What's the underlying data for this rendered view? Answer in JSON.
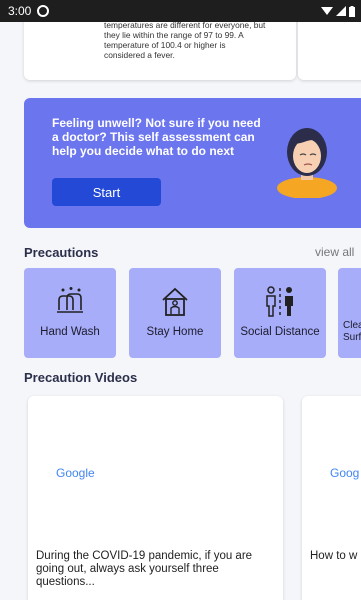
{
  "status_bar": {
    "time": "3:00"
  },
  "info_card": {
    "text": "temperatures are different for everyone, but they lie within the range of 97 to 99. A temperature of 100.4 or higher is considered a fever."
  },
  "assessment": {
    "text": "Feeling unwell? Not sure if you need a doctor? This self assessment can help you decide what to do next",
    "start_label": "Start"
  },
  "precautions": {
    "title": "Precautions",
    "view_all": "view all",
    "items": [
      {
        "label": "Hand Wash",
        "icon": "hand-wash-icon"
      },
      {
        "label": "Stay Home",
        "icon": "home-icon"
      },
      {
        "label": "Social Distance",
        "icon": "social-distance-icon"
      },
      {
        "label": "Clea Surf",
        "icon": "clean-surface-icon"
      }
    ]
  },
  "videos": {
    "title": "Precaution Videos",
    "items": [
      {
        "logo": "Google",
        "caption": "During the COVID-19 pandemic, if you are going out, always ask yourself three questions..."
      },
      {
        "logo": "Goog",
        "caption": "How to w"
      }
    ]
  },
  "colors": {
    "banner": "#6b75ee",
    "button": "#2349d6",
    "precaution_card": "#a7adf8"
  }
}
